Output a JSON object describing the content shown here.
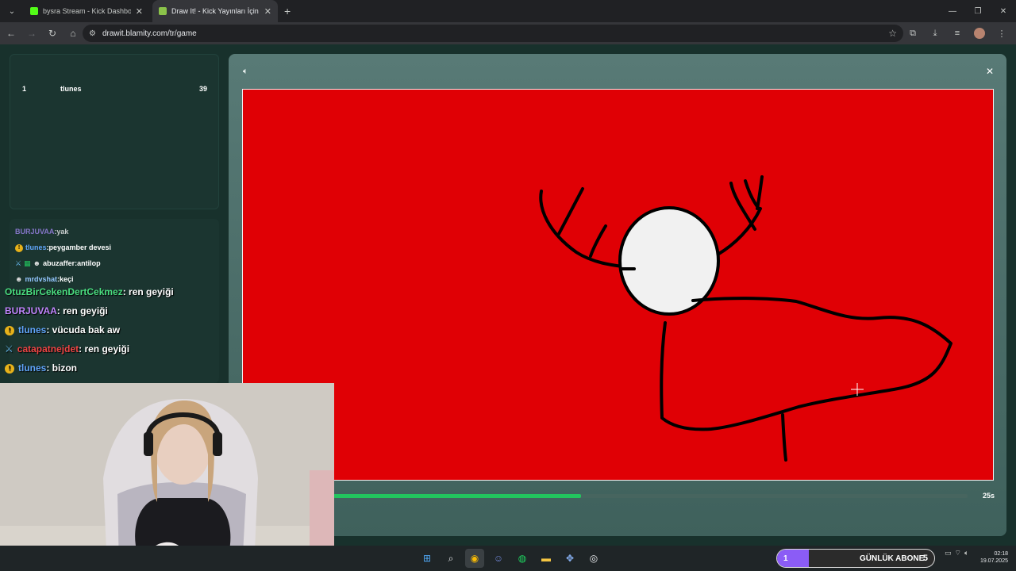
{
  "browser": {
    "tabs": [
      {
        "title": "bysra Stream - Kick Dashboard",
        "favicon_color": "#53fc18"
      },
      {
        "title": "Draw It! - Kick Yayınları İçin Çiz",
        "favicon_color": "#8bc34a"
      }
    ],
    "url": "drawit.blamity.com/tr/game"
  },
  "leaderboard": {
    "rows": [
      {
        "rank": "1",
        "name": "tlunes",
        "score": "39"
      }
    ]
  },
  "chat_small": [
    {
      "user": "BURJUVAA",
      "text": "yak",
      "color": "#a78bfa"
    },
    {
      "user": "tlunes",
      "text": "peygamber devesi",
      "color": "#60a5fa",
      "badge": "1"
    },
    {
      "user": "abuzaffer",
      "text": "antilop",
      "color": "#ffffff"
    },
    {
      "user": "mrdvshat",
      "text": "keçi",
      "color": "#93c5fd"
    }
  ],
  "chat_big": [
    {
      "user": "OtuzBirCekenDertCekmez",
      "text": ": ren geyiği",
      "color": "#4ade80"
    },
    {
      "user": "BURJUVAA",
      "text": ": ren geyiği",
      "color": "#c084fc"
    },
    {
      "user": "tlunes",
      "text": ": vücuda bak aw",
      "color": "#60a5fa",
      "badge": "1"
    },
    {
      "user": "catapatnejdet",
      "text": ": ren geyiği",
      "color": "#ef4444",
      "badge": "sword"
    },
    {
      "user": "tlunes",
      "text": ": bizon",
      "color": "#60a5fa",
      "badge": "1"
    }
  ],
  "game": {
    "canvas_color": "#e00005",
    "timer_label": "25s",
    "timer_progress": 0.39
  },
  "taskbar": {
    "goal_count": "1",
    "goal_label": "GÜNLÜK ABONE",
    "goal_target": "5",
    "goal_progress": 0.2,
    "time": "02:18",
    "date": "19.07.2025"
  }
}
